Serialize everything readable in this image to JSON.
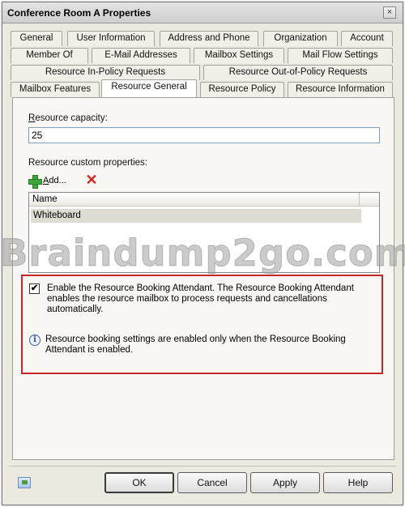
{
  "window": {
    "title": "Conference Room A Properties",
    "close_label": "×"
  },
  "tabs": {
    "row1": [
      "General",
      "User Information",
      "Address and Phone",
      "Organization",
      "Account"
    ],
    "row2": [
      "Member Of",
      "E-Mail Addresses",
      "Mailbox Settings",
      "Mail Flow Settings"
    ],
    "row3": [
      "Resource In-Policy Requests",
      "Resource Out-of-Policy Requests"
    ],
    "row4": [
      "Mailbox Features",
      "Resource General",
      "Resource Policy",
      "Resource Information"
    ],
    "active": "Resource General"
  },
  "resource_general": {
    "capacity_label_first": "R",
    "capacity_label_rest": "esource capacity:",
    "capacity_value": "25",
    "custom_props_label": "Resource custom properties:",
    "add_label_first": "A",
    "add_label_rest": "dd...",
    "list_header": "Name",
    "list_rows": [
      "Whiteboard"
    ],
    "booking_checkbox_checked": "✔",
    "booking_text": "Enable the Resource Booking Attendant. The Resource Booking Attendant enables the resource mailbox to process requests and cancellations automatically.",
    "info_icon_glyph": "i",
    "info_text": "Resource booking settings are enabled only when the Resource Booking Attendant is enabled."
  },
  "watermark": "Braindump2go.com",
  "buttons": {
    "ok": "OK",
    "cancel": "Cancel",
    "apply": "Apply",
    "help": "Help"
  },
  "colors": {
    "highlight_border": "#c8262b",
    "add_icon": "#3fa63a",
    "delete_icon": "#d12a1c"
  }
}
